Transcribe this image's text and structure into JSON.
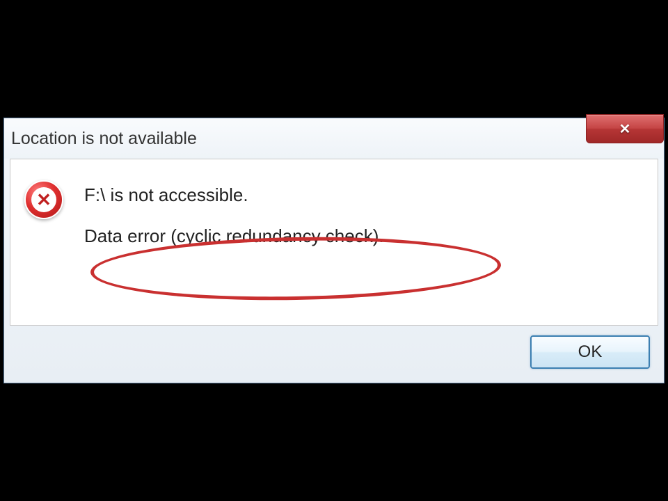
{
  "dialog": {
    "title": "Location is not available",
    "close_label": "✕",
    "message_line1": "F:\\ is not accessible.",
    "message_line2": "Data error (cyclic redundancy check).",
    "ok_label": "OK"
  }
}
